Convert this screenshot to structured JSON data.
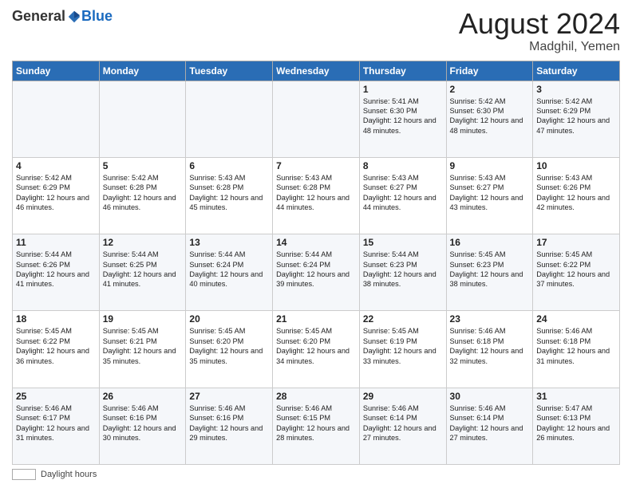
{
  "header": {
    "logo_general": "General",
    "logo_blue": "Blue",
    "month_title": "August 2024",
    "location": "Madghil, Yemen"
  },
  "days_of_week": [
    "Sunday",
    "Monday",
    "Tuesday",
    "Wednesday",
    "Thursday",
    "Friday",
    "Saturday"
  ],
  "weeks": [
    [
      {
        "day": "",
        "info": ""
      },
      {
        "day": "",
        "info": ""
      },
      {
        "day": "",
        "info": ""
      },
      {
        "day": "",
        "info": ""
      },
      {
        "day": "1",
        "info": "Sunrise: 5:41 AM\nSunset: 6:30 PM\nDaylight: 12 hours\nand 48 minutes."
      },
      {
        "day": "2",
        "info": "Sunrise: 5:42 AM\nSunset: 6:30 PM\nDaylight: 12 hours\nand 48 minutes."
      },
      {
        "day": "3",
        "info": "Sunrise: 5:42 AM\nSunset: 6:29 PM\nDaylight: 12 hours\nand 47 minutes."
      }
    ],
    [
      {
        "day": "4",
        "info": "Sunrise: 5:42 AM\nSunset: 6:29 PM\nDaylight: 12 hours\nand 46 minutes."
      },
      {
        "day": "5",
        "info": "Sunrise: 5:42 AM\nSunset: 6:28 PM\nDaylight: 12 hours\nand 46 minutes."
      },
      {
        "day": "6",
        "info": "Sunrise: 5:43 AM\nSunset: 6:28 PM\nDaylight: 12 hours\nand 45 minutes."
      },
      {
        "day": "7",
        "info": "Sunrise: 5:43 AM\nSunset: 6:28 PM\nDaylight: 12 hours\nand 44 minutes."
      },
      {
        "day": "8",
        "info": "Sunrise: 5:43 AM\nSunset: 6:27 PM\nDaylight: 12 hours\nand 44 minutes."
      },
      {
        "day": "9",
        "info": "Sunrise: 5:43 AM\nSunset: 6:27 PM\nDaylight: 12 hours\nand 43 minutes."
      },
      {
        "day": "10",
        "info": "Sunrise: 5:43 AM\nSunset: 6:26 PM\nDaylight: 12 hours\nand 42 minutes."
      }
    ],
    [
      {
        "day": "11",
        "info": "Sunrise: 5:44 AM\nSunset: 6:26 PM\nDaylight: 12 hours\nand 41 minutes."
      },
      {
        "day": "12",
        "info": "Sunrise: 5:44 AM\nSunset: 6:25 PM\nDaylight: 12 hours\nand 41 minutes."
      },
      {
        "day": "13",
        "info": "Sunrise: 5:44 AM\nSunset: 6:24 PM\nDaylight: 12 hours\nand 40 minutes."
      },
      {
        "day": "14",
        "info": "Sunrise: 5:44 AM\nSunset: 6:24 PM\nDaylight: 12 hours\nand 39 minutes."
      },
      {
        "day": "15",
        "info": "Sunrise: 5:44 AM\nSunset: 6:23 PM\nDaylight: 12 hours\nand 38 minutes."
      },
      {
        "day": "16",
        "info": "Sunrise: 5:45 AM\nSunset: 6:23 PM\nDaylight: 12 hours\nand 38 minutes."
      },
      {
        "day": "17",
        "info": "Sunrise: 5:45 AM\nSunset: 6:22 PM\nDaylight: 12 hours\nand 37 minutes."
      }
    ],
    [
      {
        "day": "18",
        "info": "Sunrise: 5:45 AM\nSunset: 6:22 PM\nDaylight: 12 hours\nand 36 minutes."
      },
      {
        "day": "19",
        "info": "Sunrise: 5:45 AM\nSunset: 6:21 PM\nDaylight: 12 hours\nand 35 minutes."
      },
      {
        "day": "20",
        "info": "Sunrise: 5:45 AM\nSunset: 6:20 PM\nDaylight: 12 hours\nand 35 minutes."
      },
      {
        "day": "21",
        "info": "Sunrise: 5:45 AM\nSunset: 6:20 PM\nDaylight: 12 hours\nand 34 minutes."
      },
      {
        "day": "22",
        "info": "Sunrise: 5:45 AM\nSunset: 6:19 PM\nDaylight: 12 hours\nand 33 minutes."
      },
      {
        "day": "23",
        "info": "Sunrise: 5:46 AM\nSunset: 6:18 PM\nDaylight: 12 hours\nand 32 minutes."
      },
      {
        "day": "24",
        "info": "Sunrise: 5:46 AM\nSunset: 6:18 PM\nDaylight: 12 hours\nand 31 minutes."
      }
    ],
    [
      {
        "day": "25",
        "info": "Sunrise: 5:46 AM\nSunset: 6:17 PM\nDaylight: 12 hours\nand 31 minutes."
      },
      {
        "day": "26",
        "info": "Sunrise: 5:46 AM\nSunset: 6:16 PM\nDaylight: 12 hours\nand 30 minutes."
      },
      {
        "day": "27",
        "info": "Sunrise: 5:46 AM\nSunset: 6:16 PM\nDaylight: 12 hours\nand 29 minutes."
      },
      {
        "day": "28",
        "info": "Sunrise: 5:46 AM\nSunset: 6:15 PM\nDaylight: 12 hours\nand 28 minutes."
      },
      {
        "day": "29",
        "info": "Sunrise: 5:46 AM\nSunset: 6:14 PM\nDaylight: 12 hours\nand 27 minutes."
      },
      {
        "day": "30",
        "info": "Sunrise: 5:46 AM\nSunset: 6:14 PM\nDaylight: 12 hours\nand 27 minutes."
      },
      {
        "day": "31",
        "info": "Sunrise: 5:47 AM\nSunset: 6:13 PM\nDaylight: 12 hours\nand 26 minutes."
      }
    ]
  ],
  "footer": {
    "legend_label": "Daylight hours"
  }
}
